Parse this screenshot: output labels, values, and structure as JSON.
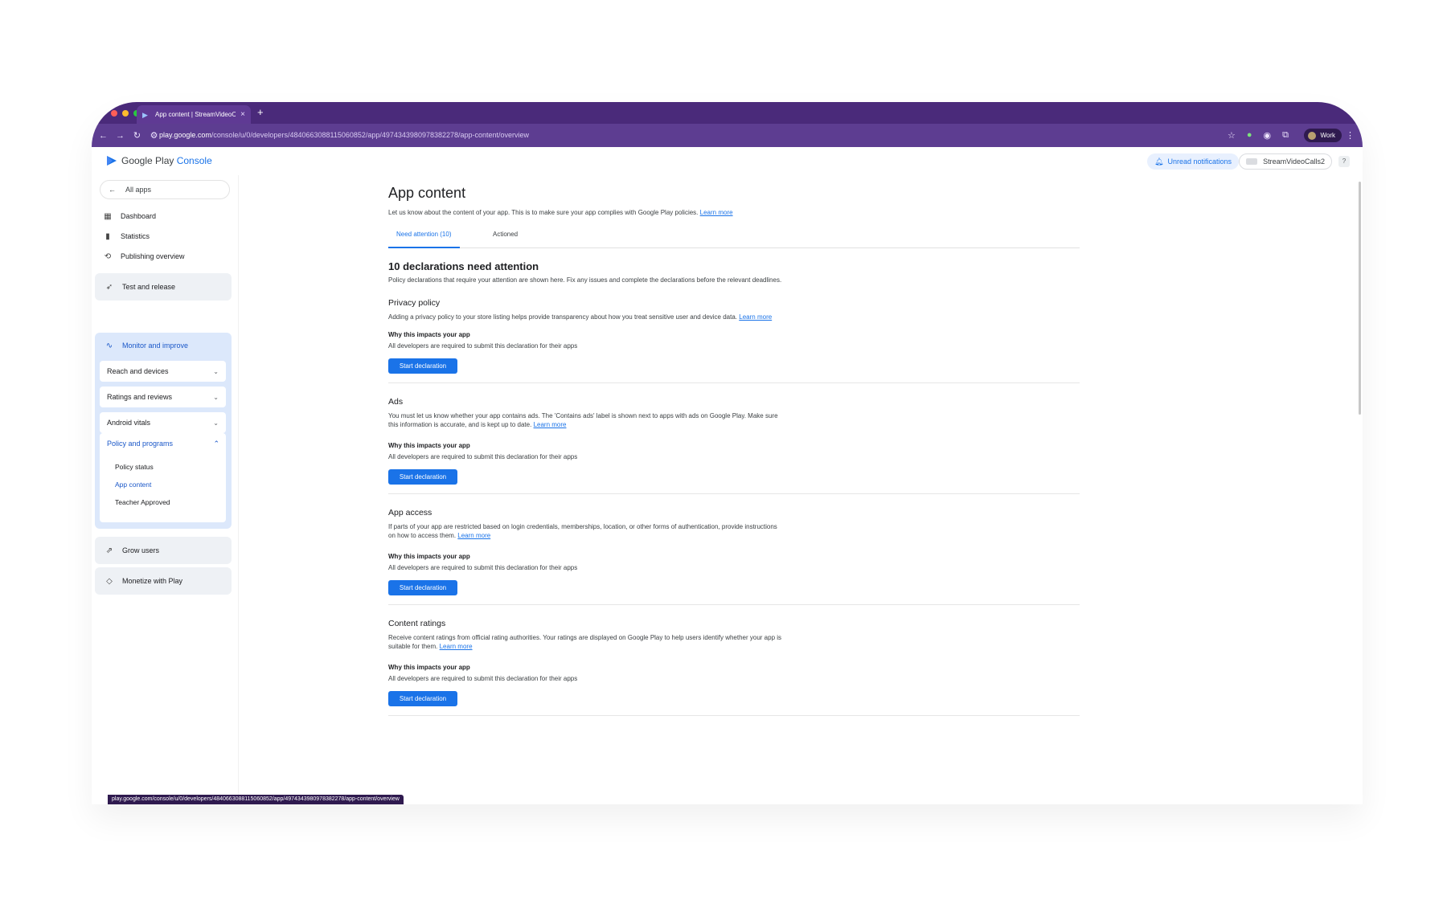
{
  "browser": {
    "tab_title": "App content | StreamVideoC...",
    "url_host": "play.google.com",
    "url_path": "/console/u/0/developers/4840663088115060852/app/4974343980978382278/app-content/overview",
    "profile_label": "Work",
    "status_url": "play.google.com/console/u/0/developers/4840663088115060852/app/4974343980978382278/app-content/overview"
  },
  "header": {
    "logo_main": "Google Play",
    "logo_accent": "Console",
    "notifications_label": "Unread notifications",
    "account_label": "StreamVideoCalls2"
  },
  "sidebar": {
    "all_apps": "All apps",
    "items": [
      {
        "label": "Dashboard",
        "icon": "dashboard-icon"
      },
      {
        "label": "Statistics",
        "icon": "statistics-icon"
      },
      {
        "label": "Publishing overview",
        "icon": "publishing-icon"
      }
    ],
    "test_release": "Test and release",
    "monitor": "Monitor and improve",
    "monitor_sub": [
      "Reach and devices",
      "Ratings and reviews",
      "Android vitals"
    ],
    "policy": "Policy and programs",
    "policy_sub": [
      "Policy status",
      "App content",
      "Teacher Approved"
    ],
    "grow": "Grow users",
    "monetize": "Monetize with Play"
  },
  "main": {
    "title": "App content",
    "description": "Let us know about the content of your app. This is to make sure your app complies with Google Play policies.",
    "learn_more": "Learn more",
    "tabs": [
      "Need attention (10)",
      "Actioned"
    ],
    "attention_title": "10 declarations need attention",
    "attention_desc": "Policy declarations that require your attention are shown here. Fix any issues and complete the declarations before the relevant deadlines.",
    "why_label": "Why this impacts your app",
    "required_text": "All developers are required to submit this declaration for their apps",
    "button_label": "Start declaration",
    "declarations": [
      {
        "title": "Privacy policy",
        "desc": "Adding a privacy policy to your store listing helps provide transparency about how you treat sensitive user and device data."
      },
      {
        "title": "Ads",
        "desc": "You must let us know whether your app contains ads. The 'Contains ads' label is shown next to apps with ads on Google Play. Make sure this information is accurate, and is kept up to date."
      },
      {
        "title": "App access",
        "desc": "If parts of your app are restricted based on login credentials, memberships, location, or other forms of authentication, provide instructions on how to access them."
      },
      {
        "title": "Content ratings",
        "desc": "Receive content ratings from official rating authorities. Your ratings are displayed on Google Play to help users identify whether your app is suitable for them."
      }
    ]
  },
  "colors": {
    "browser_frame": "#4a2a7a",
    "accent": "#1a73e8",
    "sidebar_active": "#dce8fb"
  }
}
